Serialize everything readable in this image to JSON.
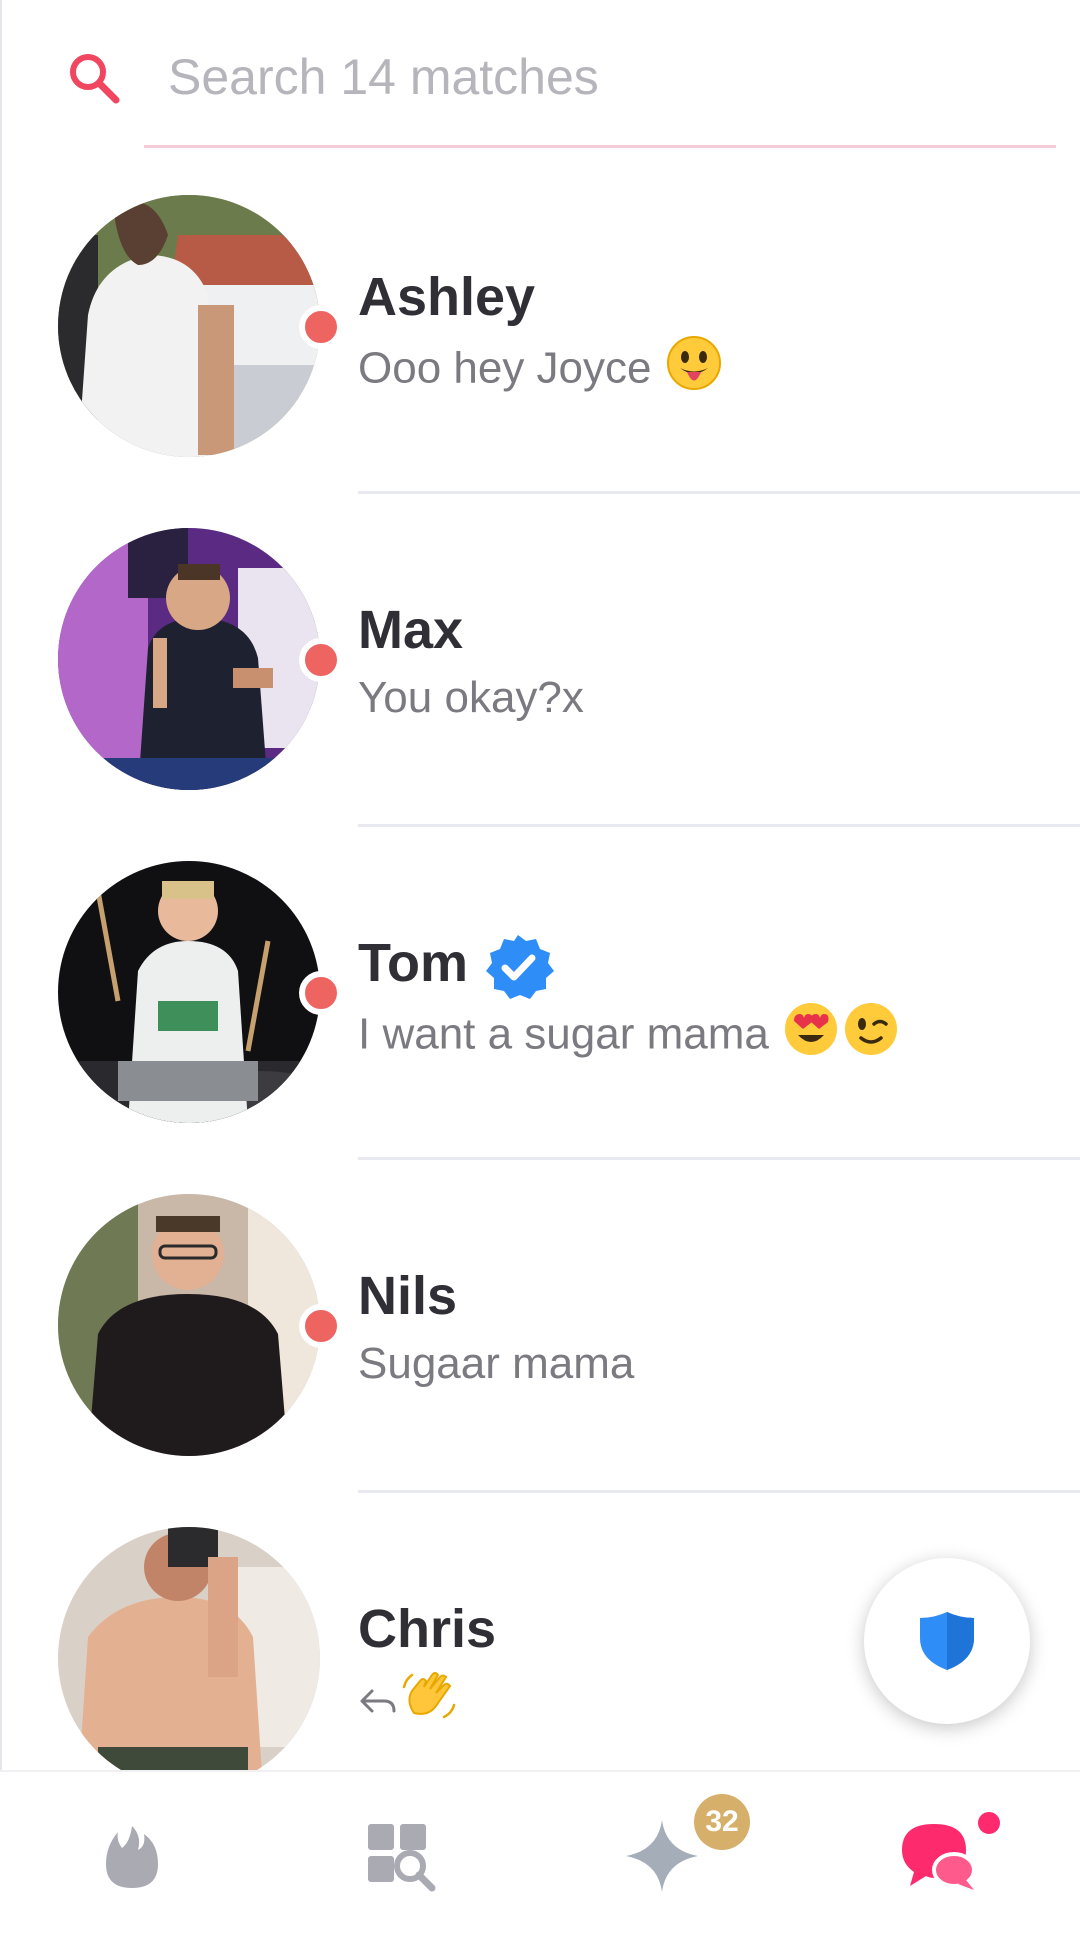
{
  "search": {
    "placeholder": "Search 14 matches",
    "icon": "search-icon"
  },
  "matches": [
    {
      "name": "Ashley",
      "message": "Ooo hey Joyce",
      "emojis": [
        "face-with-tongue-emoji"
      ],
      "unread": true,
      "verified": false
    },
    {
      "name": "Max",
      "message": "You okay?x",
      "emojis": [],
      "unread": true,
      "verified": false
    },
    {
      "name": "Tom",
      "message": "I want a sugar mama",
      "emojis": [
        "heart-eyes-emoji",
        "winking-face-emoji"
      ],
      "unread": true,
      "verified": true
    },
    {
      "name": "Nils",
      "message": "Sugaar mama",
      "emojis": [],
      "unread": true,
      "verified": false
    },
    {
      "name": "Chris",
      "message": "",
      "emojis": [
        "waving-hand-emoji"
      ],
      "replied": true,
      "unread": false,
      "verified": false
    }
  ],
  "nav": {
    "items": [
      {
        "icon": "flame-icon",
        "active": false
      },
      {
        "icon": "explore-icon",
        "active": false
      },
      {
        "icon": "sparkle-icon",
        "active": false,
        "badge": "32"
      },
      {
        "icon": "chat-bubbles-icon",
        "active": true,
        "dot": true
      }
    ]
  },
  "safety_button": {
    "icon": "shield-icon"
  },
  "colors": {
    "brand_pink": "#fd2a6e",
    "unread_dot": "#ee6461",
    "verified_blue": "#2f8df7",
    "badge_gold": "#d6b06b",
    "inactive_gray": "#a9aab2"
  }
}
